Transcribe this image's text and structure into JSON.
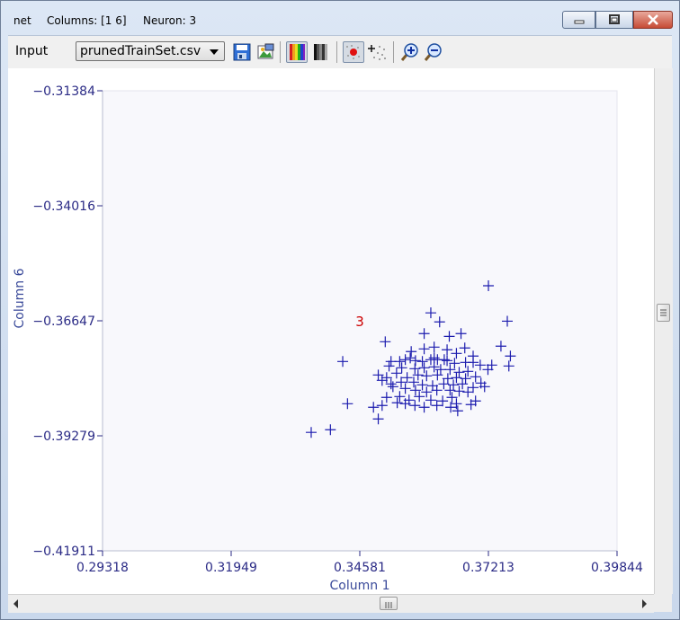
{
  "window": {
    "title_items": [
      "net",
      "Columns: [1  6]",
      "Neuron: 3"
    ],
    "buttons": [
      "minimize",
      "maximize",
      "close"
    ]
  },
  "toolbar": {
    "label": "Input",
    "file_select": "prunedTrainSet.csv",
    "icons": [
      "save-icon",
      "export-image-icon",
      "color-palette-icon",
      "grayscale-palette-icon",
      "show-neurons-icon",
      "show-data-icon",
      "zoom-in-icon",
      "zoom-out-icon"
    ]
  },
  "colors": {
    "point": "#1c1cae",
    "neuron_label": "#cc0000",
    "axis": "#2b2b86",
    "plot_bg": "#f8f8fc"
  },
  "chart_data": {
    "type": "scatter",
    "xlabel": "Column 1",
    "ylabel": "Column 6",
    "xlim": [
      0.29318,
      0.39844
    ],
    "ylim": [
      -0.41911,
      -0.31384
    ],
    "x_ticks": [
      "0.29318",
      "0.31949",
      "0.34581",
      "0.37213",
      "0.39844"
    ],
    "y_ticks": [
      "-0.31384",
      "-0.34016",
      "-0.36647",
      "-0.39279",
      "-0.41911"
    ],
    "grid": false,
    "marker": "+",
    "annotations": [
      {
        "text": "3",
        "x": 0.34581,
        "y": -0.36647
      }
    ],
    "points": [
      [
        0.37213,
        -0.35846
      ],
      [
        0.36034,
        -0.36466
      ],
      [
        0.36214,
        -0.36673
      ],
      [
        0.37599,
        -0.36657
      ],
      [
        0.35898,
        -0.36941
      ],
      [
        0.36412,
        -0.37004
      ],
      [
        0.36652,
        -0.36941
      ],
      [
        0.36102,
        -0.3725
      ],
      [
        0.36729,
        -0.3727
      ],
      [
        0.37469,
        -0.37229
      ],
      [
        0.35102,
        -0.37127
      ],
      [
        0.35898,
        -0.37291
      ],
      [
        0.36367,
        -0.37311
      ],
      [
        0.37662,
        -0.37455
      ],
      [
        0.35633,
        -0.37352
      ],
      [
        0.35613,
        -0.37497
      ],
      [
        0.36103,
        -0.37497
      ],
      [
        0.36309,
        -0.37538
      ],
      [
        0.36558,
        -0.37394
      ],
      [
        0.369,
        -0.37455
      ],
      [
        0.37045,
        -0.37661
      ],
      [
        0.37281,
        -0.37661
      ],
      [
        0.37631,
        -0.37682
      ],
      [
        0.34232,
        -0.37579
      ],
      [
        0.3522,
        -0.37579
      ],
      [
        0.35398,
        -0.37579
      ],
      [
        0.35512,
        -0.37538
      ],
      [
        0.3572,
        -0.37559
      ],
      [
        0.35861,
        -0.37579
      ],
      [
        0.36034,
        -0.37538
      ],
      [
        0.3617,
        -0.37538
      ],
      [
        0.36367,
        -0.37559
      ],
      [
        0.3652,
        -0.3762
      ],
      [
        0.36745,
        -0.376
      ],
      [
        0.369,
        -0.376
      ],
      [
        0.3518,
        -0.37682
      ],
      [
        0.35439,
        -0.37723
      ],
      [
        0.35709,
        -0.37744
      ],
      [
        0.35898,
        -0.37723
      ],
      [
        0.36102,
        -0.37703
      ],
      [
        0.36236,
        -0.37764
      ],
      [
        0.36428,
        -0.37764
      ],
      [
        0.36614,
        -0.37826
      ],
      [
        0.36793,
        -0.37805
      ],
      [
        0.37203,
        -0.37764
      ],
      [
        0.34959,
        -0.37888
      ],
      [
        0.3513,
        -0.37949
      ],
      [
        0.35333,
        -0.37846
      ],
      [
        0.35549,
        -0.37949
      ],
      [
        0.35773,
        -0.37888
      ],
      [
        0.35948,
        -0.37908
      ],
      [
        0.3617,
        -0.37888
      ],
      [
        0.36382,
        -0.3797
      ],
      [
        0.36558,
        -0.37949
      ],
      [
        0.36745,
        -0.3797
      ],
      [
        0.36949,
        -0.37929
      ],
      [
        0.35038,
        -0.38011
      ],
      [
        0.3522,
        -0.38093
      ],
      [
        0.35428,
        -0.38052
      ],
      [
        0.35685,
        -0.38052
      ],
      [
        0.35861,
        -0.38114
      ],
      [
        0.36071,
        -0.38134
      ],
      [
        0.363,
        -0.38093
      ],
      [
        0.36496,
        -0.38114
      ],
      [
        0.36681,
        -0.38093
      ],
      [
        0.369,
        -0.38175
      ],
      [
        0.3706,
        -0.38073
      ],
      [
        0.37134,
        -0.38155
      ],
      [
        0.35259,
        -0.38155
      ],
      [
        0.35512,
        -0.38196
      ],
      [
        0.3572,
        -0.38237
      ],
      [
        0.35948,
        -0.38278
      ],
      [
        0.36157,
        -0.38237
      ],
      [
        0.36428,
        -0.38237
      ],
      [
        0.36614,
        -0.38258
      ],
      [
        0.36793,
        -0.38278
      ],
      [
        0.3513,
        -0.38401
      ],
      [
        0.35398,
        -0.38381
      ],
      [
        0.35589,
        -0.38463
      ],
      [
        0.35799,
        -0.38381
      ],
      [
        0.36034,
        -0.38463
      ],
      [
        0.36276,
        -0.38483
      ],
      [
        0.36467,
        -0.38401
      ],
      [
        0.36558,
        -0.38545
      ],
      [
        0.36949,
        -0.38483
      ],
      [
        0.35038,
        -0.38586
      ],
      [
        0.35347,
        -0.38524
      ],
      [
        0.35512,
        -0.38545
      ],
      [
        0.35709,
        -0.38586
      ],
      [
        0.35898,
        -0.38627
      ],
      [
        0.36157,
        -0.38586
      ],
      [
        0.36441,
        -0.38627
      ],
      [
        0.36584,
        -0.38709
      ],
      [
        0.3433,
        -0.38545
      ],
      [
        0.34959,
        -0.38893
      ],
      [
        0.36857,
        -0.38565
      ],
      [
        0.3398,
        -0.3914
      ],
      [
        0.33587,
        -0.39201
      ],
      [
        0.34861,
        -0.38627
      ]
    ]
  }
}
